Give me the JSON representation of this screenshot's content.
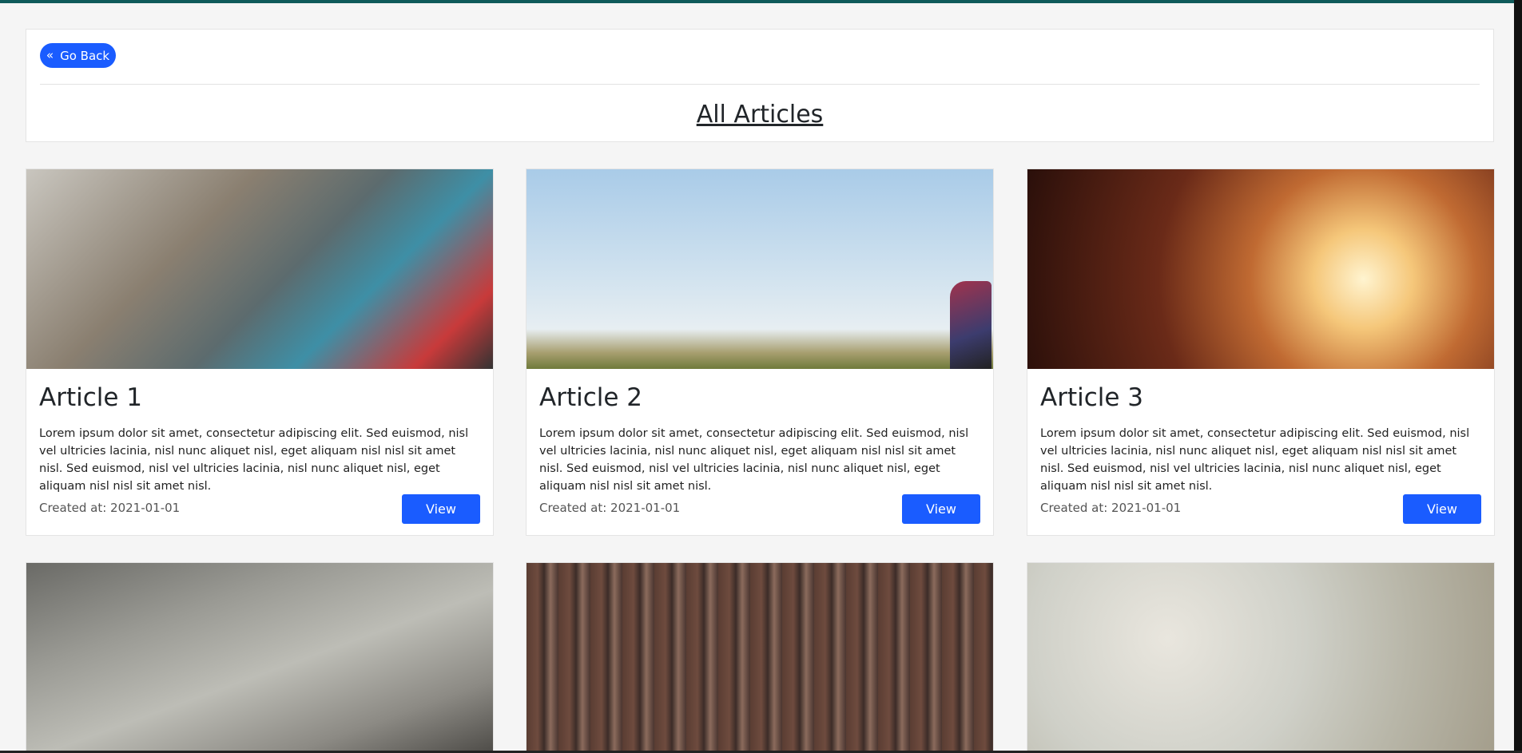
{
  "header": {
    "back_label": "Go Back",
    "back_icon": "double-chevron-left-icon",
    "title": "All Articles"
  },
  "articles": [
    {
      "title": "Article 1",
      "text": "Lorem ipsum dolor sit amet, consectetur adipiscing elit. Sed euismod, nisl vel ultricies lacinia, nisl nunc aliquet nisl, eget aliquam nisl nisl sit amet nisl. Sed euismod, nisl vel ultricies lacinia, nisl nunc aliquet nisl, eget aliquam nisl nisl sit amet nisl.",
      "date": "Created at: 2021-01-01",
      "button": "View"
    },
    {
      "title": "Article 2",
      "text": "Lorem ipsum dolor sit amet, consectetur adipiscing elit. Sed euismod, nisl vel ultricies lacinia, nisl nunc aliquet nisl, eget aliquam nisl nisl sit amet nisl. Sed euismod, nisl vel ultricies lacinia, nisl nunc aliquet nisl, eget aliquam nisl nisl sit amet nisl.",
      "date": "Created at: 2021-01-01",
      "button": "View"
    },
    {
      "title": "Article 3",
      "text": "Lorem ipsum dolor sit amet, consectetur adipiscing elit. Sed euismod, nisl vel ultricies lacinia, nisl nunc aliquet nisl, eget aliquam nisl nisl sit amet nisl. Sed euismod, nisl vel ultricies lacinia, nisl nunc aliquet nisl, eget aliquam nisl nisl sit amet nisl.",
      "date": "Created at: 2021-01-01",
      "button": "View"
    }
  ],
  "colors": {
    "accent": "#1a5cff",
    "topbar": "#0f5a5a",
    "background": "#f5f5f5"
  }
}
